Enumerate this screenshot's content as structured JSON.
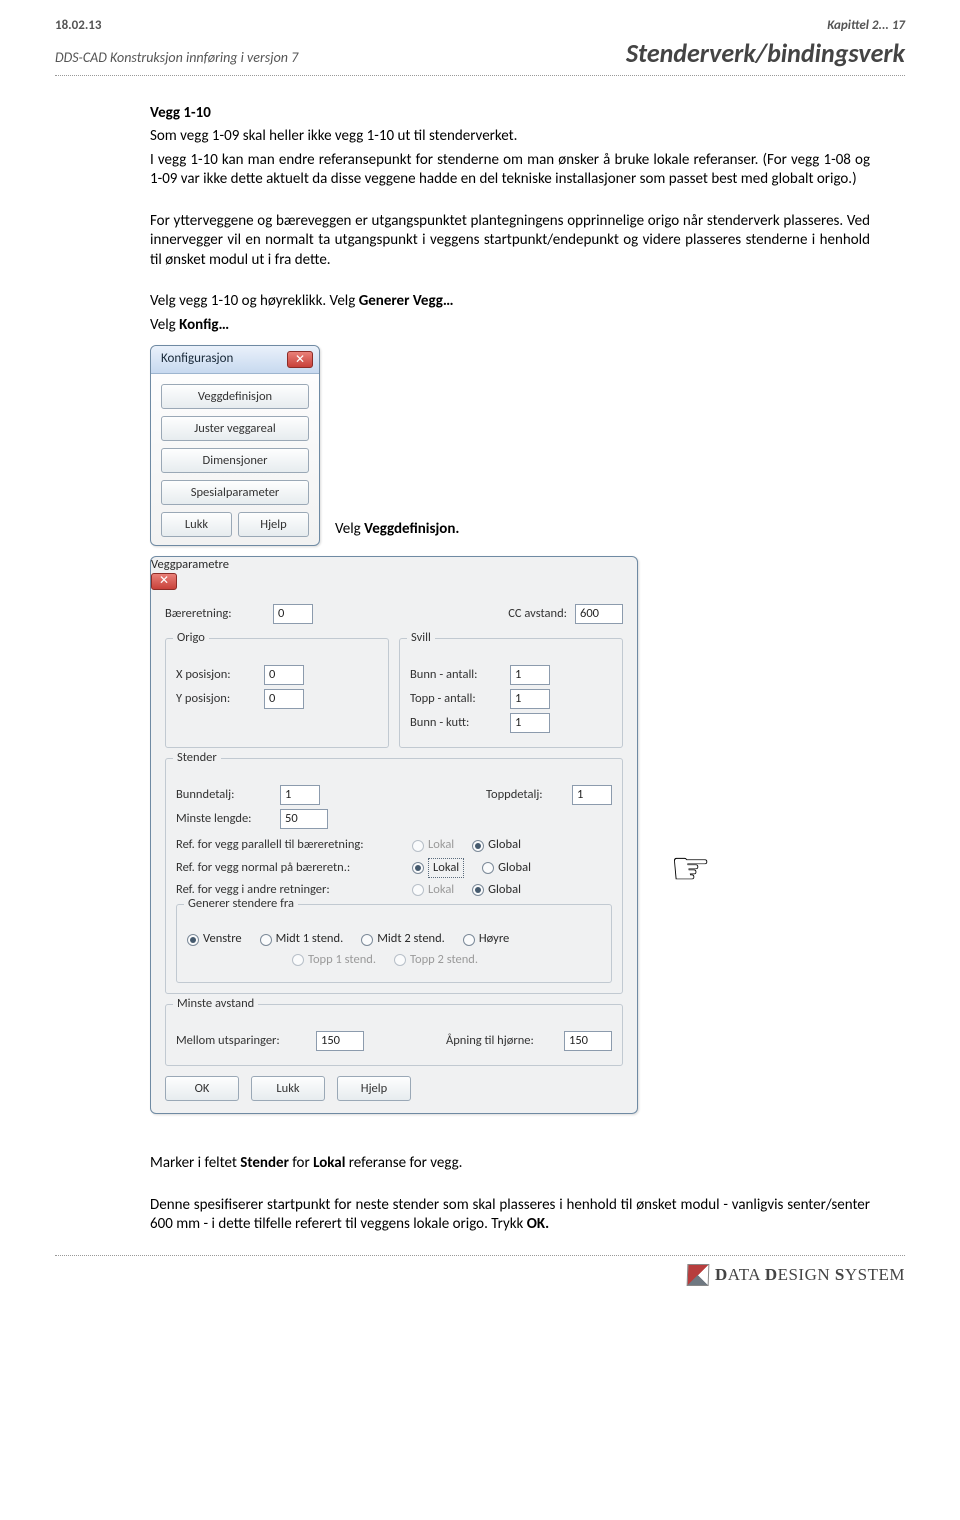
{
  "header": {
    "date": "18.02.13",
    "kapittel": "Kapittel 2... 17",
    "docname": "DDS-CAD Konstruksjon innføring i versjon  7",
    "chapter_title": "Stenderverk/bindingsverk"
  },
  "section": {
    "title": "Vegg 1-10",
    "p1": "Som vegg 1-09 skal heller ikke vegg 1-10 ut til stenderverket.",
    "p2": "I vegg 1-10 kan man endre referansepunkt for stenderne om man ønsker å bruke lokale referanser. (For vegg 1-08 og 1-09 var ikke dette aktuelt da disse veggene hadde en del tekniske installasjoner som passet best med globalt origo.)",
    "p3": "For ytterveggene og bæreveggen er utgangspunktet plantegningens opprinnelige origo når stenderverk plasseres. Ved innervegger vil en normalt ta utgangspunkt i veggens startpunkt/endepunkt og videre plasseres stenderne i henhold til ønsket modul ut i fra dette.",
    "p4a": "Velg vegg 1-10 og høyreklikk. Velg ",
    "p4b": "Generer Vegg…",
    "p5a": "Velg ",
    "p5b": "Konfig…"
  },
  "dlg1": {
    "title": "Konfigurasjon",
    "b1": "Veggdefinisjon",
    "b2": "Juster veggareal",
    "b3": "Dimensjoner",
    "b4": "Spesialparameter",
    "b5": "Lukk",
    "b6": "Hjelp"
  },
  "caption1a": "Velg ",
  "caption1b": "Veggdefinisjon.",
  "dlg2": {
    "title": "Veggparametre",
    "bareretn_l": "Bæreretning:",
    "bareretn_v": "0",
    "cc_l": "CC avstand:",
    "cc_v": "600",
    "origo_title": "Origo",
    "svill_title": "Svill",
    "xpos_l": "X posisjon:",
    "xpos_v": "0",
    "ypos_l": "Y posisjon:",
    "ypos_v": "0",
    "bunn_ant_l": "Bunn - antall:",
    "bunn_ant_v": "1",
    "topp_ant_l": "Topp - antall:",
    "topp_ant_v": "1",
    "bunn_kutt_l": "Bunn - kutt:",
    "bunn_kutt_v": "1",
    "stender_title": "Stender",
    "bd_l": "Bunndetalj:",
    "bd_v": "1",
    "td_l": "Toppdetalj:",
    "td_v": "1",
    "ml_l": "Minste lengde:",
    "ml_v": "50",
    "ref1": "Ref. for vegg parallell til bæreretning:",
    "ref2": "Ref. for vegg normal på bæreretn.:",
    "ref3": "Ref. for vegg i andre retninger:",
    "lokal": "Lokal",
    "global": "Global",
    "gen_title": "Generer stendere fra",
    "g1": "Venstre",
    "g2": "Midt 1 stend.",
    "g3": "Midt 2 stend.",
    "g4": "Høyre",
    "g5": "Topp 1 stend.",
    "g6": "Topp 2 stend.",
    "mav_title": "Minste avstand",
    "muts_l": "Mellom utsparinger:",
    "muts_v": "150",
    "apn_l": "Åpning til hjørne:",
    "apn_v": "150",
    "ok": "OK",
    "lukk": "Lukk",
    "hjelp": "Hjelp"
  },
  "after": {
    "p1a": "Marker i feltet ",
    "p1b": "Stender",
    "p1c": " for ",
    "p1d": "Lokal",
    "p1e": " referanse for vegg.",
    "p2a": "Denne spesifiserer startpunkt for neste stender som skal plasseres i henhold til ønsket modul - vanligvis senter/senter 600 mm - i dette tilfelle referert til veggens lokale origo.  Trykk ",
    "p2b": "OK."
  },
  "footer": {
    "brand1": "D",
    "brand2": "ATA ",
    "brand3": "D",
    "brand4": "ESIGN ",
    "brand5": "S",
    "brand6": "YSTEM"
  }
}
